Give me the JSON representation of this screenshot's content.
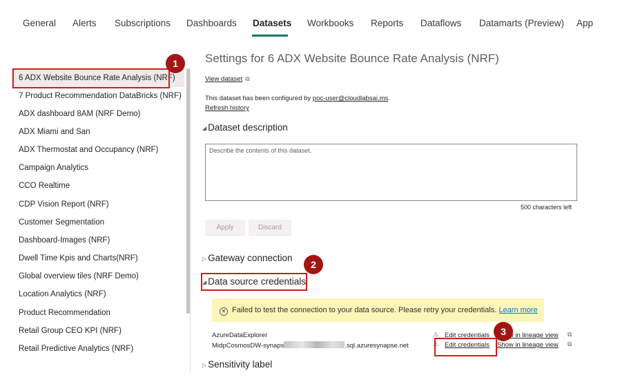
{
  "tabs": [
    {
      "label": "General"
    },
    {
      "label": "Alerts"
    },
    {
      "label": "Subscriptions"
    },
    {
      "label": "Dashboards"
    },
    {
      "label": "Datasets"
    },
    {
      "label": "Workbooks"
    },
    {
      "label": "Reports"
    },
    {
      "label": "Dataflows"
    },
    {
      "label": "Datamarts (Preview)"
    },
    {
      "label": "App"
    }
  ],
  "sidebar": {
    "items": [
      {
        "label": "6 ADX Website Bounce Rate Analysis (NRF)"
      },
      {
        "label": "7 Product Recommendation DataBricks (NRF)"
      },
      {
        "label": "ADX dashboard 8AM (NRF Demo)"
      },
      {
        "label": "ADX Miami and San"
      },
      {
        "label": "ADX Thermostat and Occupancy (NRF)"
      },
      {
        "label": "Campaign Analytics"
      },
      {
        "label": "CCO Realtime"
      },
      {
        "label": "CDP Vision Report (NRF)"
      },
      {
        "label": "Customer Segmentation"
      },
      {
        "label": "Dashboard-Images (NRF)"
      },
      {
        "label": "Dwell Time Kpis and Charts(NRF)"
      },
      {
        "label": "Global overview tiles (NRF Demo)"
      },
      {
        "label": "Location Analytics (NRF)"
      },
      {
        "label": "Product Recommendation"
      },
      {
        "label": "Retail Group CEO KPI (NRF)"
      },
      {
        "label": "Retail Predictive Analytics (NRF)"
      }
    ]
  },
  "main": {
    "title": "Settings for 6 ADX Website Bounce Rate Analysis (NRF)",
    "view_dataset": "View dataset",
    "configured_prefix": "This dataset has been configured by ",
    "configured_user": "poc-user@cloudlabsai.ms",
    "configured_suffix": ".",
    "refresh_history": "Refresh history",
    "description_heading": "Dataset description",
    "description_placeholder": "Describe the contents of this dataset.",
    "chars_left": "500 characters left",
    "apply": "Apply",
    "discard": "Discard",
    "gateway_heading": "Gateway connection",
    "credentials_heading": "Data source credentials",
    "warning_text": "Failed to test the connection to your data source. Please retry your credentials.",
    "learn_more": "Learn more",
    "sources": [
      {
        "name": "AzureDataExplorer",
        "edit": "Edit credentials",
        "lineage": "Show in lineage view"
      },
      {
        "name_prefix": "MidpCosmosDW-synaps",
        "name_suffix": ".sql.azuresynapse.net",
        "edit": "Edit credentials",
        "lineage": "Show in lineage view"
      }
    ],
    "sensitivity_heading": "Sensitivity label"
  },
  "annotations": [
    "1",
    "2",
    "3"
  ],
  "colors": {
    "accent": "#117865",
    "annotation": "#d11b1b",
    "warning_bg": "#fbf5b8"
  }
}
